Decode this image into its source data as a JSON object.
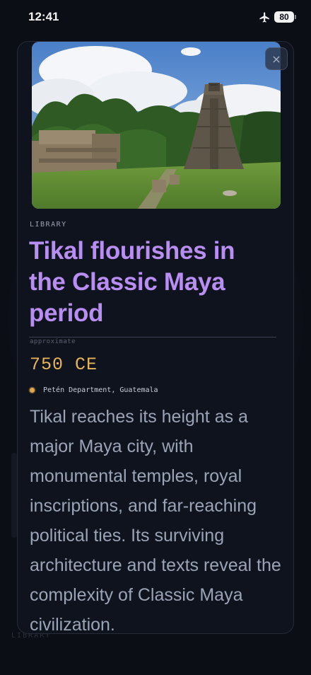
{
  "status_bar": {
    "time": "12:41",
    "battery": "80"
  },
  "background": {
    "footer_hint": "LIBRARY"
  },
  "card": {
    "category": "LIBRARY",
    "title": "Tikal flourishes in the Classic Maya period",
    "date_qualifier": "approximate",
    "date": "750 CE",
    "location": "Petén Department, Guatemala",
    "description": "Tikal reaches its height as a major Maya city, with monumental temples, royal inscriptions, and far-reaching political ties. Its surviving architecture and texts reveal the complexity of Classic Maya civilization.",
    "close_label": "×"
  },
  "colors": {
    "title": "#b98ef2",
    "date": "#e8b45a",
    "location_dot": "#e0a84a",
    "body": "#9ba4b6",
    "background": "#0b0e15"
  }
}
